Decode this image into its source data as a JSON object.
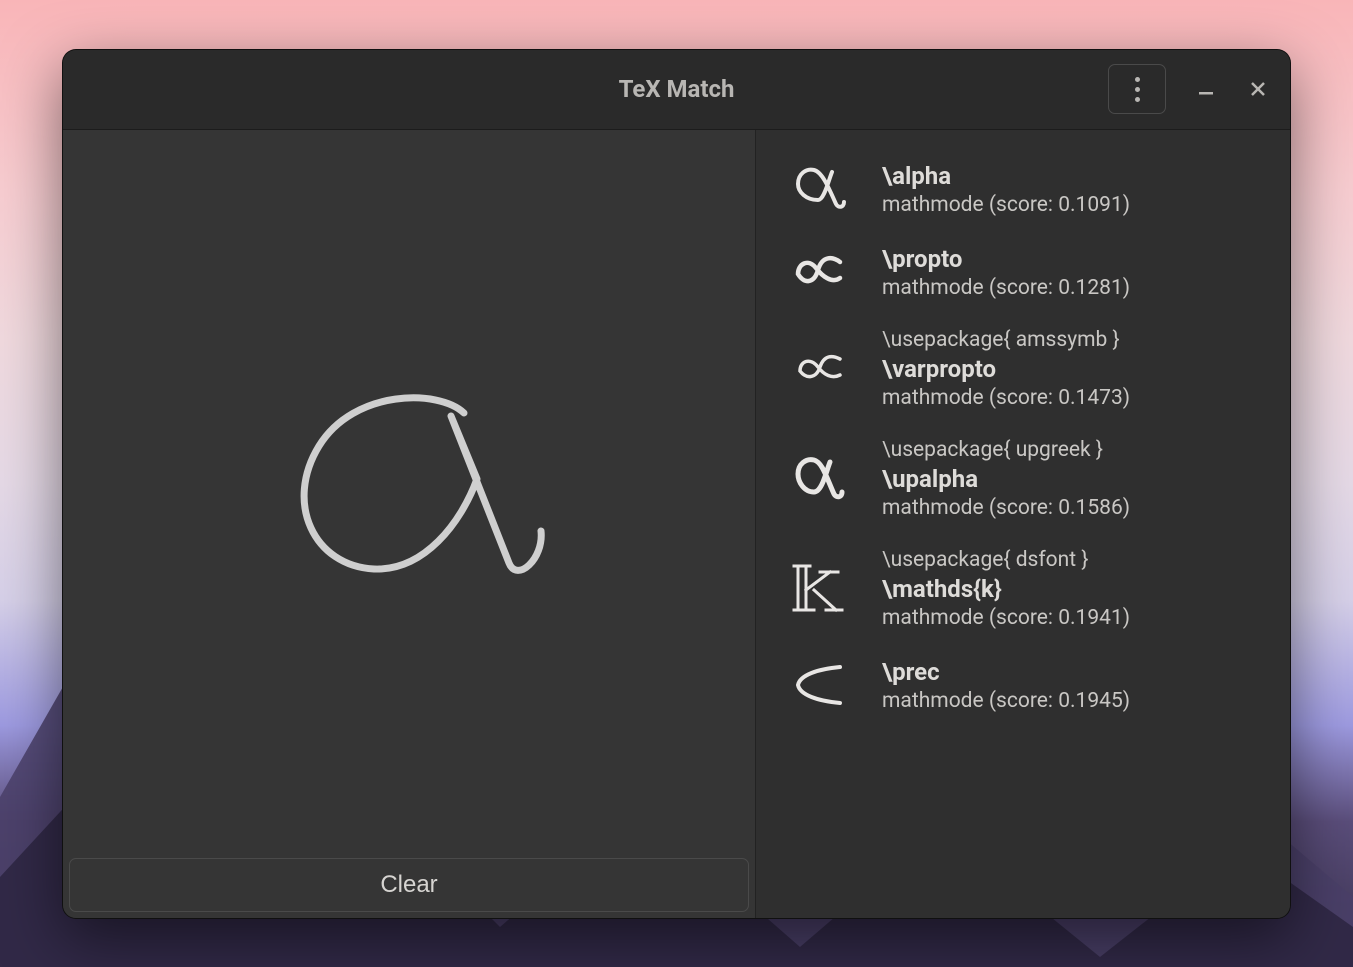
{
  "header": {
    "title": "TeX Match"
  },
  "buttons": {
    "clear_label": "Clear"
  },
  "results": [
    {
      "package": null,
      "command": "\\alpha",
      "mode": "mathmode (score: 0.1091)",
      "glyph": "alpha"
    },
    {
      "package": null,
      "command": "\\propto",
      "mode": "mathmode (score: 0.1281)",
      "glyph": "propto"
    },
    {
      "package": "\\usepackage{ amssymb }",
      "command": "\\varpropto",
      "mode": "mathmode (score: 0.1473)",
      "glyph": "varpropto"
    },
    {
      "package": "\\usepackage{ upgreek }",
      "command": "\\upalpha",
      "mode": "mathmode (score: 0.1586)",
      "glyph": "upalpha"
    },
    {
      "package": "\\usepackage{ dsfont }",
      "command": "\\mathds{k}",
      "mode": "mathmode (score: 0.1941)",
      "glyph": "dsk"
    },
    {
      "package": null,
      "command": "\\prec",
      "mode": "mathmode (score: 0.1945)",
      "glyph": "prec"
    }
  ]
}
